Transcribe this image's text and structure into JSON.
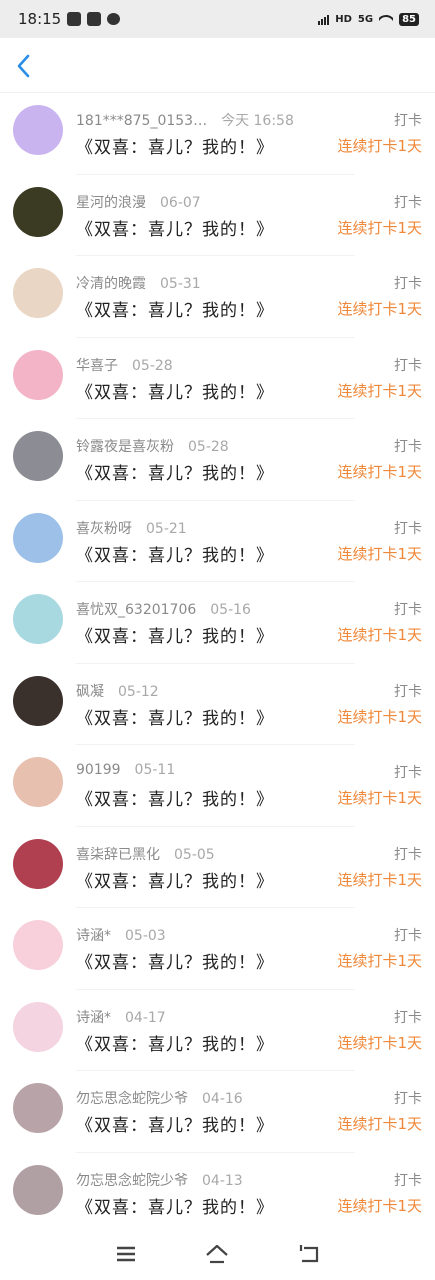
{
  "status_bar": {
    "time": "18:15",
    "network": "5G",
    "hd": "HD",
    "battery": "85"
  },
  "header": {
    "back_icon": "chevron-left-icon"
  },
  "list": [
    {
      "name": "181***875_0153…",
      "date": "今天 16:58",
      "title": "《双喜：喜儿？我的！》",
      "tag": "打卡",
      "streak": "连续打卡1天",
      "avatar_color": "#c9b4f0"
    },
    {
      "name": "星河的浪漫",
      "date": "06-07",
      "title": "《双喜：喜儿？我的！》",
      "tag": "打卡",
      "streak": "连续打卡1天",
      "avatar_color": "#3b3a22"
    },
    {
      "name": "冷清的晚霞",
      "date": "05-31",
      "title": "《双喜：喜儿？我的！》",
      "tag": "打卡",
      "streak": "连续打卡1天",
      "avatar_color": "#e9d6c4"
    },
    {
      "name": "华喜子",
      "date": "05-28",
      "title": "《双喜：喜儿？我的！》",
      "tag": "打卡",
      "streak": "连续打卡1天",
      "avatar_color": "#f4b4c8"
    },
    {
      "name": "铃露夜是喜灰粉",
      "date": "05-28",
      "title": "《双喜：喜儿？我的！》",
      "tag": "打卡",
      "streak": "连续打卡1天",
      "avatar_color": "#8c8c94"
    },
    {
      "name": "喜灰粉呀",
      "date": "05-21",
      "title": "《双喜：喜儿？我的！》",
      "tag": "打卡",
      "streak": "连续打卡1天",
      "avatar_color": "#9cc0e8"
    },
    {
      "name": "喜忧双_63201706",
      "date": "05-16",
      "title": "《双喜：喜儿？我的！》",
      "tag": "打卡",
      "streak": "连续打卡1天",
      "avatar_color": "#a8d8e0"
    },
    {
      "name": "砜凝",
      "date": "05-12",
      "title": "《双喜：喜儿？我的！》",
      "tag": "打卡",
      "streak": "连续打卡1天",
      "avatar_color": "#3a302c"
    },
    {
      "name": "90199",
      "date": "05-11",
      "title": "《双喜：喜儿？我的！》",
      "tag": "打卡",
      "streak": "连续打卡1天",
      "avatar_color": "#e8c0b0"
    },
    {
      "name": "喜柒辞已黑化",
      "date": "05-05",
      "title": "《双喜：喜儿？我的！》",
      "tag": "打卡",
      "streak": "连续打卡1天",
      "avatar_color": "#b04050"
    },
    {
      "name": "诗涵*",
      "date": "05-03",
      "title": "《双喜：喜儿？我的！》",
      "tag": "打卡",
      "streak": "连续打卡1天",
      "avatar_color": "#f8d0dc"
    },
    {
      "name": "诗涵*",
      "date": "04-17",
      "title": "《双喜：喜儿？我的！》",
      "tag": "打卡",
      "streak": "连续打卡1天",
      "avatar_color": "#f4d4e0"
    },
    {
      "name": "勿忘思念蛇院少爷",
      "date": "04-16",
      "title": "《双喜：喜儿？我的！》",
      "tag": "打卡",
      "streak": "连续打卡1天",
      "avatar_color": "#b8a4a8"
    },
    {
      "name": "勿忘思念蛇院少爷",
      "date": "04-13",
      "title": "《双喜：喜儿？我的！》",
      "tag": "打卡",
      "streak": "连续打卡1天",
      "avatar_color": "#b0a0a4"
    }
  ],
  "colors": {
    "accent": "#2a8ee8",
    "streak": "#f0883a"
  }
}
